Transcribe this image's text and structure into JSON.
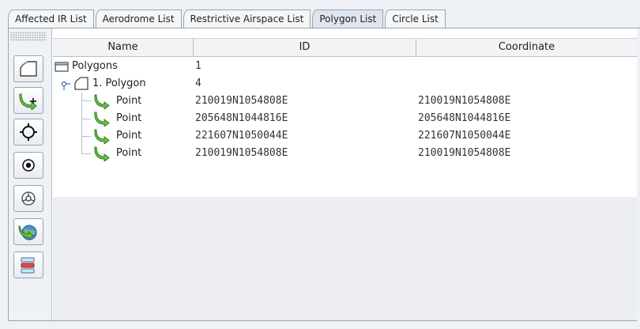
{
  "tabs": [
    {
      "label": "Affected IR List",
      "active": false
    },
    {
      "label": "Aerodrome List",
      "active": false
    },
    {
      "label": "Restrictive Airspace List",
      "active": false
    },
    {
      "label": "Polygon List",
      "active": true
    },
    {
      "label": "Circle List",
      "active": false
    }
  ],
  "toolbar": {
    "icons": [
      "polygon-shape-icon",
      "add-point-icon",
      "crosshair-icon",
      "circle-target-icon",
      "steering-wheel-icon",
      "globe-arrow-icon",
      "list-remove-icon"
    ]
  },
  "table": {
    "headers": {
      "name": "Name",
      "id": "ID",
      "coordinate": "Coordinate"
    },
    "root": {
      "name": "Polygons",
      "id": "1"
    },
    "polygon": {
      "name": "1. Polygon",
      "id": "4"
    },
    "points": [
      {
        "name": "Point",
        "id": "210019N1054808E",
        "coordinate": "210019N1054808E"
      },
      {
        "name": "Point",
        "id": "205648N1044816E",
        "coordinate": "205648N1044816E"
      },
      {
        "name": "Point",
        "id": "221607N1050044E",
        "coordinate": "221607N1050044E"
      },
      {
        "name": "Point",
        "id": "210019N1054808E",
        "coordinate": "210019N1054808E"
      }
    ]
  },
  "colors": {
    "tab_active": "#dde5ef",
    "empty_area": "#eceef1",
    "icon_green": "#4caf50"
  }
}
